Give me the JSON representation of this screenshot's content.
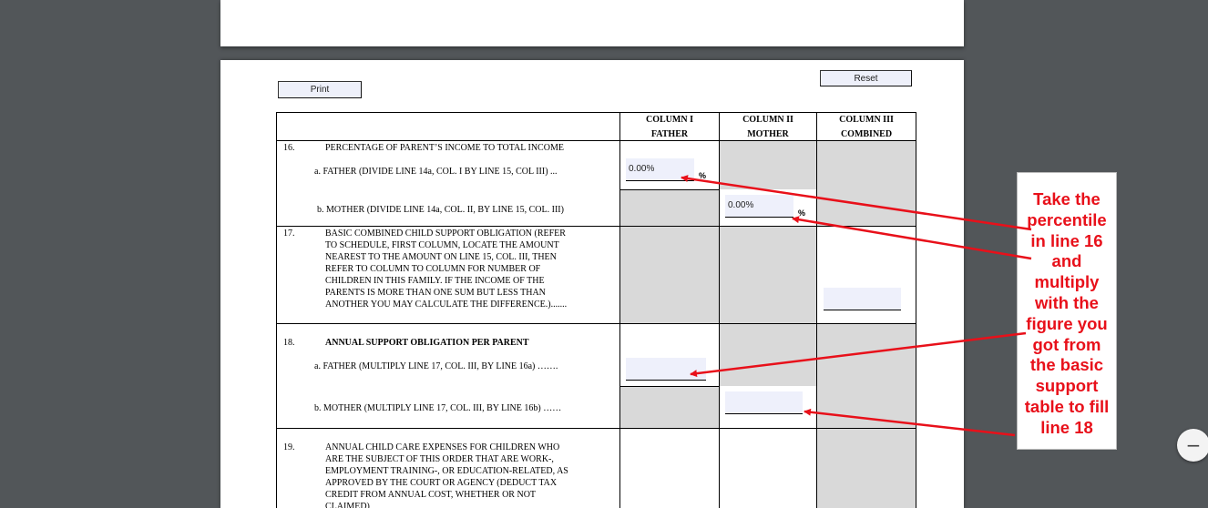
{
  "buttons": {
    "print": "Print",
    "reset": "Reset"
  },
  "columns": {
    "col1": "COLUMN I",
    "col1_sub": "FATHER",
    "col2": "COLUMN II",
    "col2_sub": "MOTHER",
    "col3": "COLUMN III",
    "col3_sub": "COMBINED"
  },
  "rows": {
    "r16": {
      "num": "16.",
      "title": "PERCENTAGE OF PARENT’S INCOME TO TOTAL INCOME",
      "a": "a. FATHER (DIVIDE LINE 14a, COL. I BY LINE 15, COL III) ...",
      "b": "b. MOTHER (DIVIDE LINE 14a, COL. II, BY LINE 15, COL. III)",
      "father_value": "0.00%",
      "mother_value": "0.00%",
      "percent_sign": "%"
    },
    "r17": {
      "num": "17.",
      "lines": [
        "BASIC COMBINED CHILD SUPPORT OBLIGATION (REFER",
        "TO SCHEDULE, FIRST COLUMN, LOCATE THE AMOUNT",
        "NEAREST TO THE AMOUNT ON LINE 15, COL. III, THEN",
        "REFER TO COLUMN TO COLUMN FOR NUMBER OF",
        "CHILDREN IN THIS FAMILY. IF THE INCOME OF THE",
        "PARENTS IS MORE THAN ONE SUM BUT LESS THAN",
        "ANOTHER YOU MAY CALCULATE THE DIFFERENCE.)......."
      ]
    },
    "r18": {
      "num": "18.",
      "title": "ANNUAL SUPPORT OBLIGATION PER PARENT",
      "a": "a. FATHER (MULTIPLY LINE 17, COL. III, BY LINE 16a) …….",
      "b": "b. MOTHER (MULTIPLY LINE 17, COL. III, BY LINE 16b) ……"
    },
    "r19": {
      "num": "19.",
      "lines": [
        "ANNUAL CHILD CARE EXPENSES FOR CHILDREN WHO",
        "ARE THE SUBJECT OF THIS ORDER THAT ARE WORK-,",
        "EMPLOYMENT TRAINING-, OR EDUCATION-RELATED, AS",
        "APPROVED BY THE COURT OR AGENCY (DEDUCT TAX",
        "CREDIT FROM ANNUAL COST, WHETHER OR NOT",
        "CLAIMED)"
      ]
    }
  },
  "callout": {
    "lines": [
      "Take the",
      "percentile",
      "in line 16",
      "and",
      "multiply",
      "with the",
      "figure you",
      "got from",
      "the basic",
      "support",
      "table to fill",
      "line 18"
    ]
  },
  "zoom": {
    "out_label": "−"
  },
  "colors": {
    "annotation": "#e8101a",
    "viewer_bg": "#525659",
    "field_bg": "#eef0fb",
    "shade": "#d9d9d9"
  }
}
